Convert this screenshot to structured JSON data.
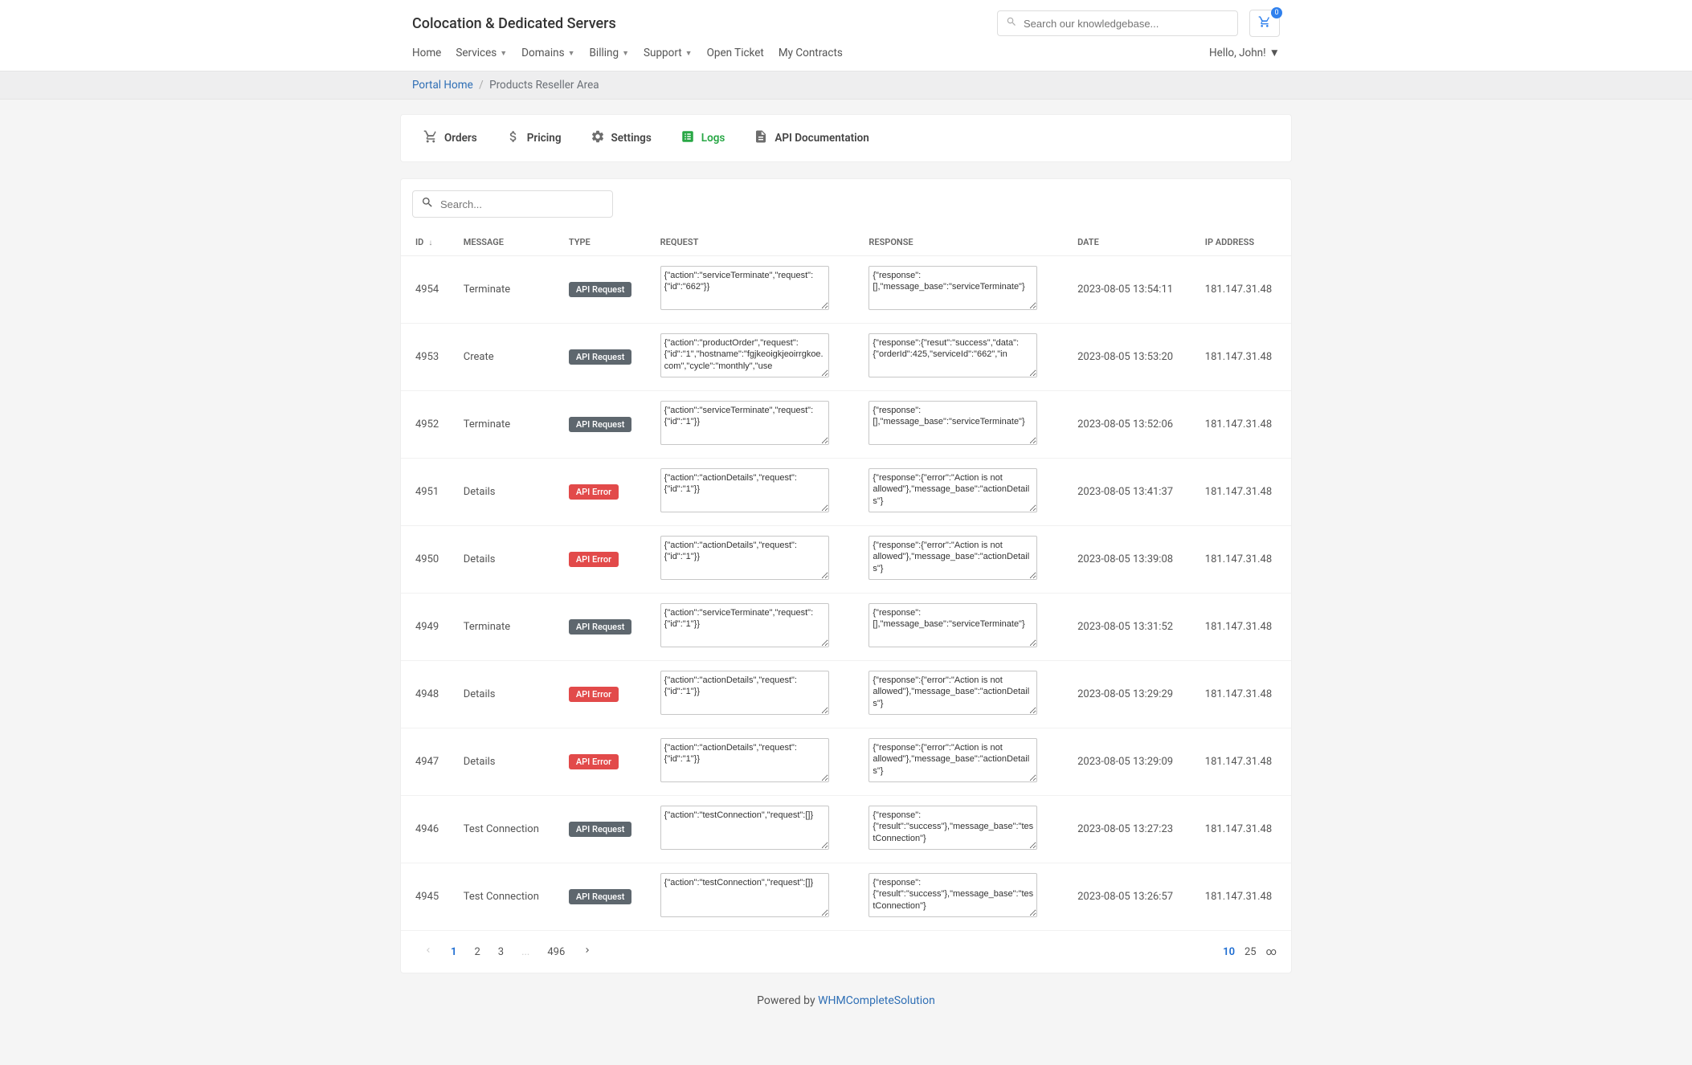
{
  "brand": "Colocation & Dedicated Servers",
  "search": {
    "placeholder": "Search our knowledgebase..."
  },
  "cart": {
    "count": "0"
  },
  "nav": {
    "items": [
      {
        "label": "Home",
        "caret": false
      },
      {
        "label": "Services",
        "caret": true
      },
      {
        "label": "Domains",
        "caret": true
      },
      {
        "label": "Billing",
        "caret": true
      },
      {
        "label": "Support",
        "caret": true
      },
      {
        "label": "Open Ticket",
        "caret": false
      },
      {
        "label": "My Contracts",
        "caret": false
      }
    ],
    "user": "Hello, John!"
  },
  "breadcrumb": {
    "home": "Portal Home",
    "current": "Products Reseller Area"
  },
  "tabs": [
    {
      "key": "orders",
      "label": "Orders",
      "icon": "cart"
    },
    {
      "key": "pricing",
      "label": "Pricing",
      "icon": "dollar"
    },
    {
      "key": "settings",
      "label": "Settings",
      "icon": "gear"
    },
    {
      "key": "logs",
      "label": "Logs",
      "icon": "doc-list",
      "active": true
    },
    {
      "key": "api",
      "label": "API Documentation",
      "icon": "doc"
    }
  ],
  "table": {
    "search_placeholder": "Search...",
    "columns": [
      "ID",
      "MESSAGE",
      "TYPE",
      "REQUEST",
      "RESPONSE",
      "DATE",
      "IP ADDRESS"
    ],
    "rows": [
      {
        "id": "4954",
        "message": "Terminate",
        "type": "API Request",
        "type_class": "request",
        "request": "{\"action\":\"serviceTerminate\",\"request\":{\"id\":\"662\"}}",
        "response": "{\"response\":[],\"message_base\":\"serviceTerminate\"}",
        "date": "2023-08-05 13:54:11",
        "ip": "181.147.31.48"
      },
      {
        "id": "4953",
        "message": "Create",
        "type": "API Request",
        "type_class": "request",
        "request": "{\"action\":\"productOrder\",\"request\":{\"id\":\"1\",\"hostname\":\"fgjkeoigkjeoirrgkoe.com\",\"cycle\":\"monthly\",\"use",
        "response": "{\"response\":{\"resut\":\"success\",\"data\":{\"orderId\":425,\"serviceId\":\"662\",\"in",
        "date": "2023-08-05 13:53:20",
        "ip": "181.147.31.48"
      },
      {
        "id": "4952",
        "message": "Terminate",
        "type": "API Request",
        "type_class": "request",
        "request": "{\"action\":\"serviceTerminate\",\"request\":{\"id\":\"1\"}}",
        "response": "{\"response\":[],\"message_base\":\"serviceTerminate\"}",
        "date": "2023-08-05 13:52:06",
        "ip": "181.147.31.48"
      },
      {
        "id": "4951",
        "message": "Details",
        "type": "API Error",
        "type_class": "error",
        "request": "{\"action\":\"actionDetails\",\"request\":{\"id\":\"1\"}}",
        "response": "{\"response\":{\"error\":\"Action is not allowed\"},\"message_base\":\"actionDetails\"}",
        "date": "2023-08-05 13:41:37",
        "ip": "181.147.31.48"
      },
      {
        "id": "4950",
        "message": "Details",
        "type": "API Error",
        "type_class": "error",
        "request": "{\"action\":\"actionDetails\",\"request\":{\"id\":\"1\"}}",
        "response": "{\"response\":{\"error\":\"Action is not allowed\"},\"message_base\":\"actionDetails\"}",
        "date": "2023-08-05 13:39:08",
        "ip": "181.147.31.48"
      },
      {
        "id": "4949",
        "message": "Terminate",
        "type": "API Request",
        "type_class": "request",
        "request": "{\"action\":\"serviceTerminate\",\"request\":{\"id\":\"1\"}}",
        "response": "{\"response\":[],\"message_base\":\"serviceTerminate\"}",
        "date": "2023-08-05 13:31:52",
        "ip": "181.147.31.48"
      },
      {
        "id": "4948",
        "message": "Details",
        "type": "API Error",
        "type_class": "error",
        "request": "{\"action\":\"actionDetails\",\"request\":{\"id\":\"1\"}}",
        "response": "{\"response\":{\"error\":\"Action is not allowed\"},\"message_base\":\"actionDetails\"}",
        "date": "2023-08-05 13:29:29",
        "ip": "181.147.31.48"
      },
      {
        "id": "4947",
        "message": "Details",
        "type": "API Error",
        "type_class": "error",
        "request": "{\"action\":\"actionDetails\",\"request\":{\"id\":\"1\"}}",
        "response": "{\"response\":{\"error\":\"Action is not allowed\"},\"message_base\":\"actionDetails\"}",
        "date": "2023-08-05 13:29:09",
        "ip": "181.147.31.48"
      },
      {
        "id": "4946",
        "message": "Test Connection",
        "type": "API Request",
        "type_class": "request",
        "request": "{\"action\":\"testConnection\",\"request\":[]}",
        "response": "{\"response\":{\"result\":\"success\"},\"message_base\":\"testConnection\"}",
        "date": "2023-08-05 13:27:23",
        "ip": "181.147.31.48"
      },
      {
        "id": "4945",
        "message": "Test Connection",
        "type": "API Request",
        "type_class": "request",
        "request": "{\"action\":\"testConnection\",\"request\":[]}",
        "response": "{\"response\":{\"result\":\"success\"},\"message_base\":\"testConnection\"}",
        "date": "2023-08-05 13:26:57",
        "ip": "181.147.31.48"
      }
    ],
    "pagination": {
      "pages": [
        "1",
        "2",
        "3",
        "...",
        "496"
      ],
      "active": "1",
      "perpage": {
        "current": "10",
        "options": [
          "25",
          "∞"
        ]
      }
    }
  },
  "footer": {
    "prefix": "Powered by ",
    "link": "WHMCompleteSolution"
  }
}
